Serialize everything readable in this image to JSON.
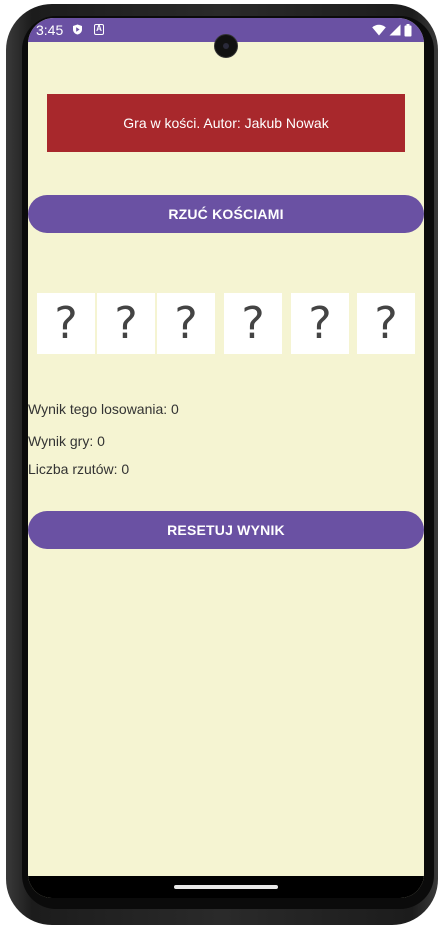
{
  "status_bar": {
    "time": "3:45",
    "background": "#6a51a3"
  },
  "app": {
    "background": "#f5f4d2",
    "title": "Gra w kości. Autor: Jakub Nowak",
    "title_color": "#a8282c",
    "accent": "#6a51a3",
    "roll_button_label": "RZUĆ KOŚCIAMI",
    "dice": [
      "?",
      "?",
      "?",
      "?",
      "?",
      "?"
    ],
    "stats": {
      "roll_score": "Wynik tego losowania: 0",
      "game_score": "Wynik gry: 0",
      "roll_count": "Liczba rzutów: 0"
    },
    "reset_button_label": "RESETUJ WYNIK"
  },
  "icons": {
    "status": [
      "play-protect-icon",
      "accessibility-a-icon",
      "wifi-icon",
      "cellular-signal-icon",
      "battery-icon"
    ],
    "camera": "front-camera-icon",
    "navigation": "home-gesture-handle-icon"
  }
}
